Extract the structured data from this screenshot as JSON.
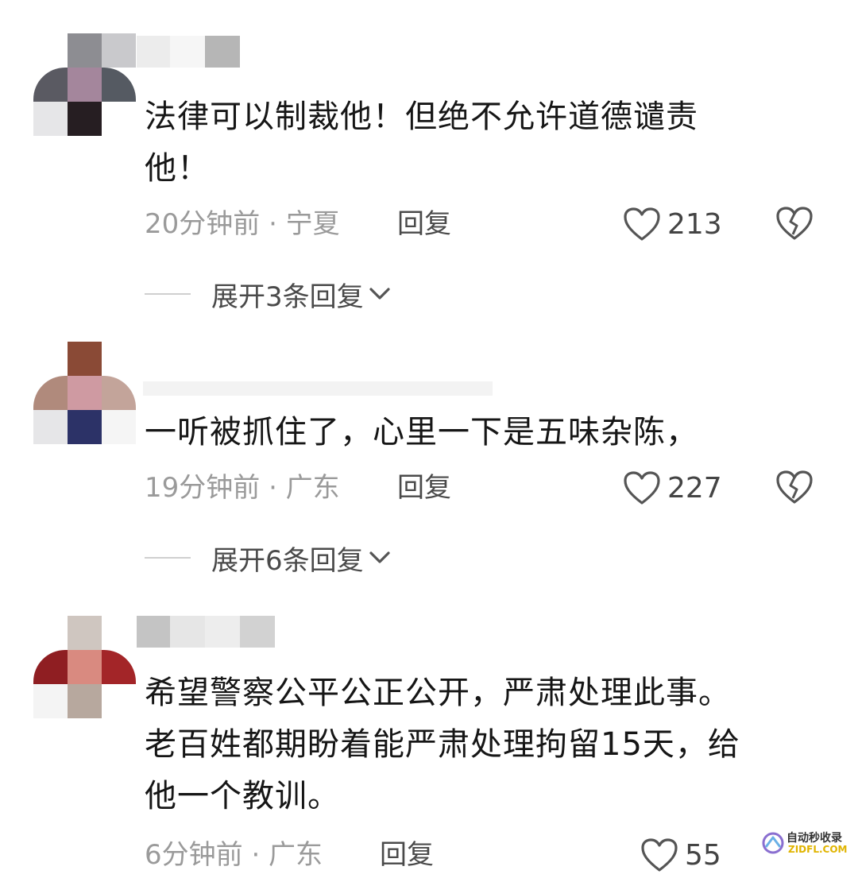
{
  "comments": [
    {
      "text_lines": [
        "法律可以制裁他！但绝不允许道德谴责",
        "他！"
      ],
      "meta": "20分钟前 · 宁夏",
      "reply_label": "回复",
      "likes": "213",
      "expand_label": "展开3条回复"
    },
    {
      "text_lines": [
        "一听被抓住了，心里一下是五味杂陈，"
      ],
      "meta": "19分钟前 · 广东",
      "reply_label": "回复",
      "likes": "227",
      "expand_label": "展开6条回复"
    },
    {
      "text_lines": [
        "希望警察公平公正公开，严肃处理此事。",
        "老百姓都期盼着能严肃处理拘留15天，给",
        "他一个教训。"
      ],
      "meta": "6分钟前 · 广东",
      "reply_label": "回复",
      "likes": "55"
    }
  ],
  "watermark": {
    "line1": "自动秒收录",
    "line2": "ZIDFL.COM"
  },
  "colors": {
    "meta": "#9a9a9a",
    "text": "#161616",
    "icon": "#555555"
  }
}
